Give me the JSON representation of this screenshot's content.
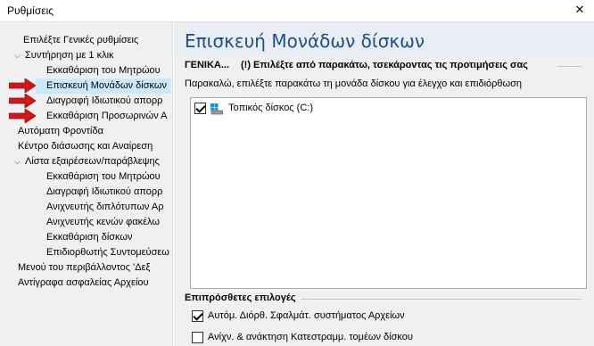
{
  "window": {
    "title": "Ρυθμίσεις",
    "close_glyph": "✕"
  },
  "colors": {
    "selected_row": "#cce8ff",
    "header_bg": "#e9eef5",
    "header_text": "#1f4e8c",
    "arrow": "#d0171b"
  },
  "sidebar": {
    "items": [
      {
        "label": "Επιλέξτε Γενικές ρυθμίσεις",
        "expander": ""
      },
      {
        "label": "Συντήρηση με 1 κλικ",
        "expander": "⌵"
      },
      {
        "label": "Εκκαθάριση του Μητρώου",
        "expander": ""
      },
      {
        "label": "Επισκευή Μονάδων δίσκων",
        "expander": "",
        "selected": true
      },
      {
        "label": "Διαγραφή Ιδιωτικού απορρ",
        "expander": ""
      },
      {
        "label": "Εκκαθάριση Προσωρινών Α",
        "expander": ""
      },
      {
        "label": "Αυτόματη Φροντίδα",
        "expander": ""
      },
      {
        "label": "Κέντρο διάσωσης και Αναίρεση",
        "expander": ""
      },
      {
        "label": "Λίστα εξαιρέσεων/παράβλεψης",
        "expander": "⌵"
      },
      {
        "label": "Εκκαθάριση του Μητρώου",
        "expander": ""
      },
      {
        "label": "Διαγραφή Ιδιωτικού απορρ",
        "expander": ""
      },
      {
        "label": "Ανιχνευτής διπλότυπων Αρ",
        "expander": ""
      },
      {
        "label": "Ανιχνευτής κενών φακέλω",
        "expander": ""
      },
      {
        "label": "Εκκαθάριση δίσκων",
        "expander": ""
      },
      {
        "label": "Επιδιορθωτής Συντομεύσεω",
        "expander": ""
      },
      {
        "label": "Μενού του περιβάλλοντος 'Δεξ",
        "expander": ""
      },
      {
        "label": "Αντίγραφα ασφαλείας Αρχείου",
        "expander": ""
      }
    ]
  },
  "main": {
    "title": "Επισκευή Μονάδων δίσκων",
    "general_label": "ΓΕΝΙΚΑ...",
    "general_hint": "(!) Επιλέξτε από παρακάτω, τσεκάροντας τις προτιμήσεις σας",
    "instruction": "Παρακαλώ, επιλέξτε παρακάτω τη μονάδα δίσκου για έλεγχο και επιδιόρθωση",
    "drives": [
      {
        "label": "Τοπικός δίσκος (C:)",
        "checked": true,
        "icon": "drive-icon"
      }
    ],
    "extra_title": "Επιπρόσθετες επιλογές",
    "options": [
      {
        "label": "Αυτόμ. Διόρθ. Σφαλμάτ. συστήματος Αρχείων",
        "checked": true
      },
      {
        "label": "Ανίχν. & ανάκτηση Κατεστραμμ. τομέων δίσκου",
        "checked": false
      }
    ]
  }
}
